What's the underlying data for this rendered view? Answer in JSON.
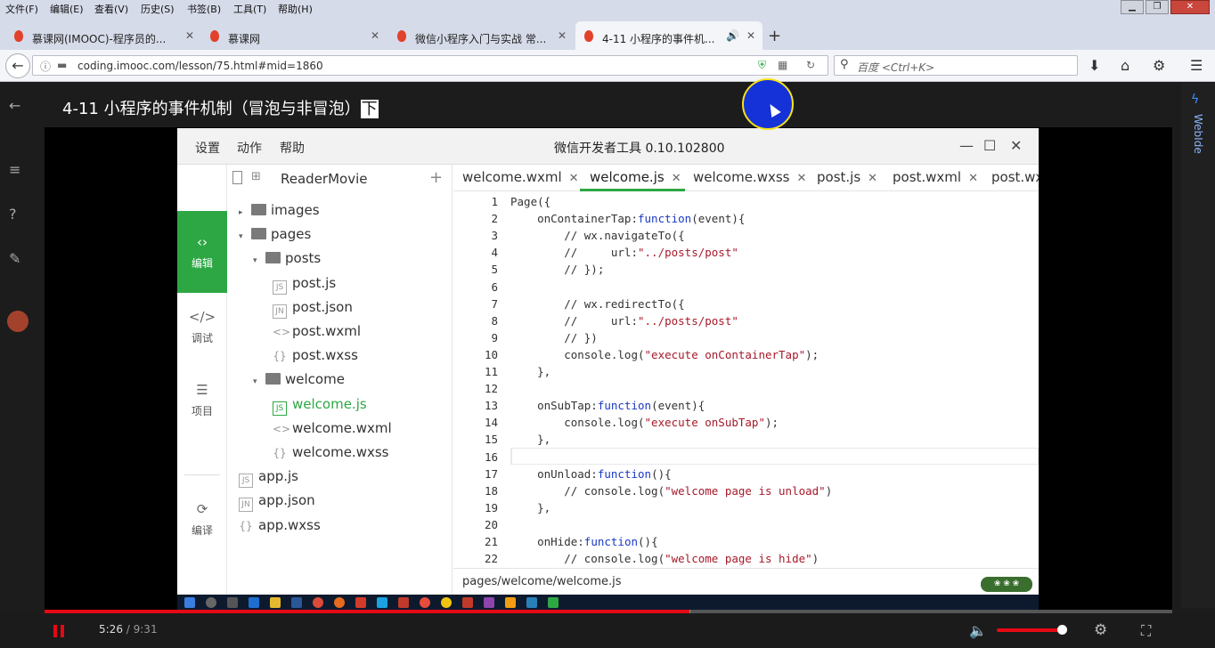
{
  "menu": [
    "文件(F)",
    "编辑(E)",
    "查看(V)",
    "历史(S)",
    "书签(B)",
    "工具(T)",
    "帮助(H)"
  ],
  "window_buttons": {
    "minimize": "▁",
    "maximize": "❐",
    "close": "✕"
  },
  "tabs": [
    {
      "label": "慕课网(IMOOC)-程序员的..."
    },
    {
      "label": "慕课网"
    },
    {
      "label": "微信小程序入门与实战 常..."
    },
    {
      "label": "4-11 小程序的事件机..."
    }
  ],
  "tab_close": "✕",
  "tab_audio": "🔊",
  "new_tab": "+",
  "address": {
    "url": "coding.imooc.com/lesson/75.html#mid=1860"
  },
  "search": {
    "placeholder": "百度 <Ctrl+K>"
  },
  "video": {
    "title": "4-11 小程序的事件机制（冒泡与非冒泡）",
    "title_highlight": "下",
    "side_label": "WebIde"
  },
  "ide": {
    "menu": [
      "设置",
      "动作",
      "帮助"
    ],
    "title": "微信开发者工具 0.10.102800",
    "rail": [
      {
        "label": "编辑",
        "icon": "‹›"
      },
      {
        "label": "调试",
        "icon": "</>"
      },
      {
        "label": "项目",
        "icon": "☰"
      },
      {
        "label": "编译",
        "icon": "⟳"
      }
    ],
    "rail_close": "✕",
    "project_name": "ReaderMovie",
    "add": "+",
    "tree": [
      {
        "label": "images",
        "kind": "folder",
        "caret": "▸",
        "level": 0
      },
      {
        "label": "pages",
        "kind": "folder",
        "caret": "▾",
        "level": 0
      },
      {
        "label": "posts",
        "kind": "folder",
        "caret": "▾",
        "level": 1
      },
      {
        "label": "post.js",
        "kind": "js",
        "level": 2
      },
      {
        "label": "post.json",
        "kind": "json",
        "level": 2
      },
      {
        "label": "post.wxml",
        "kind": "wxml",
        "level": 2
      },
      {
        "label": "post.wxss",
        "kind": "wxss",
        "level": 2
      },
      {
        "label": "welcome",
        "kind": "folder",
        "caret": "▾",
        "level": 1
      },
      {
        "label": "welcome.js",
        "kind": "js",
        "level": 2,
        "selected": true
      },
      {
        "label": "welcome.wxml",
        "kind": "wxml",
        "level": 2
      },
      {
        "label": "welcome.wxss",
        "kind": "wxss",
        "level": 2
      },
      {
        "label": "app.js",
        "kind": "js",
        "level": 0
      },
      {
        "label": "app.json",
        "kind": "json",
        "level": 0
      },
      {
        "label": "app.wxss",
        "kind": "wxss",
        "level": 0
      }
    ],
    "file_badges": {
      "js": "JS",
      "json": "JN",
      "wxml": "<>",
      "wxss": "{}"
    },
    "editor_tabs": [
      {
        "label": "welcome.wxml"
      },
      {
        "label": "welcome.js",
        "active": true
      },
      {
        "label": "welcome.wxss"
      },
      {
        "label": "post.js"
      },
      {
        "label": "post.wxml"
      },
      {
        "label": "post.wx"
      }
    ],
    "code": [
      "Page({",
      "    onContainerTap:function(event){",
      "        // wx.navigateTo({",
      "        //     url:\"../posts/post\"",
      "        // });",
      "",
      "        // wx.redirectTo({",
      "        //     url:\"../posts/post\"",
      "        // })",
      "        console.log(\"execute onContainerTap\");",
      "    },",
      "",
      "    onSubTap:function(event){",
      "        console.log(\"execute onSubTap\");",
      "    },",
      "",
      "    onUnload:function(){",
      "        // console.log(\"welcome page is unload\")",
      "    },",
      "",
      "    onHide:function(){",
      "        // console.log(\"welcome page is hide\")"
    ],
    "status_path": "pages/welcome/welcome.js"
  },
  "player": {
    "current": "5:26",
    "separator": " / ",
    "total": "9:31",
    "played_fraction": 0.572,
    "volume_fraction": 0.9
  },
  "colors": {
    "accent_green": "#2da744",
    "progress_red": "#e50914",
    "keyword_blue": "#1a39c4",
    "string_red": "#a6192a"
  }
}
